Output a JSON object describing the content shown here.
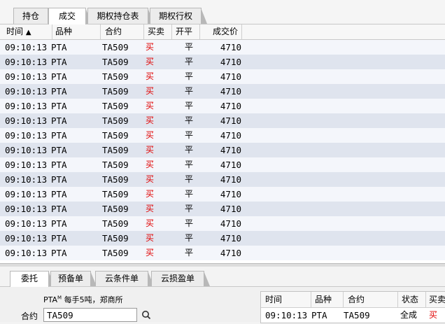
{
  "top_tabs": [
    {
      "label": "持仓",
      "active": false
    },
    {
      "label": "成交",
      "active": true
    },
    {
      "label": "期权持仓表",
      "active": false
    },
    {
      "label": "期权行权",
      "active": false
    }
  ],
  "trades": {
    "columns": {
      "time": "时间",
      "sort_indicator": "▲",
      "product": "品种",
      "contract": "合约",
      "side": "买卖",
      "open_close": "开平",
      "price": "成交价"
    },
    "rows": [
      {
        "time": "09:10:13",
        "product": "PTA",
        "contract": "TA509",
        "side": "买",
        "open_close": "平",
        "price": "4710"
      },
      {
        "time": "09:10:13",
        "product": "PTA",
        "contract": "TA509",
        "side": "买",
        "open_close": "平",
        "price": "4710"
      },
      {
        "time": "09:10:13",
        "product": "PTA",
        "contract": "TA509",
        "side": "买",
        "open_close": "平",
        "price": "4710"
      },
      {
        "time": "09:10:13",
        "product": "PTA",
        "contract": "TA509",
        "side": "买",
        "open_close": "平",
        "price": "4710"
      },
      {
        "time": "09:10:13",
        "product": "PTA",
        "contract": "TA509",
        "side": "买",
        "open_close": "平",
        "price": "4710"
      },
      {
        "time": "09:10:13",
        "product": "PTA",
        "contract": "TA509",
        "side": "买",
        "open_close": "平",
        "price": "4710"
      },
      {
        "time": "09:10:13",
        "product": "PTA",
        "contract": "TA509",
        "side": "买",
        "open_close": "平",
        "price": "4710"
      },
      {
        "time": "09:10:13",
        "product": "PTA",
        "contract": "TA509",
        "side": "买",
        "open_close": "平",
        "price": "4710"
      },
      {
        "time": "09:10:13",
        "product": "PTA",
        "contract": "TA509",
        "side": "买",
        "open_close": "平",
        "price": "4710"
      },
      {
        "time": "09:10:13",
        "product": "PTA",
        "contract": "TA509",
        "side": "买",
        "open_close": "平",
        "price": "4710"
      },
      {
        "time": "09:10:13",
        "product": "PTA",
        "contract": "TA509",
        "side": "买",
        "open_close": "平",
        "price": "4710"
      },
      {
        "time": "09:10:13",
        "product": "PTA",
        "contract": "TA509",
        "side": "买",
        "open_close": "平",
        "price": "4710"
      },
      {
        "time": "09:10:13",
        "product": "PTA",
        "contract": "TA509",
        "side": "买",
        "open_close": "平",
        "price": "4710"
      },
      {
        "time": "09:10:13",
        "product": "PTA",
        "contract": "TA509",
        "side": "买",
        "open_close": "平",
        "price": "4710"
      },
      {
        "time": "09:10:13",
        "product": "PTA",
        "contract": "TA509",
        "side": "买",
        "open_close": "平",
        "price": "4710"
      }
    ]
  },
  "bottom_tabs": [
    {
      "label": "委托",
      "active": true
    },
    {
      "label": "预备单",
      "active": false
    },
    {
      "label": "云条件单",
      "active": false
    },
    {
      "label": "云损盈单",
      "active": false
    }
  ],
  "order_panel": {
    "product_info_prefix": "PTA",
    "product_info_sup": "M",
    "product_info_rest": " 每手5吨，郑商所",
    "contract_label": "合约",
    "contract_value": "TA509",
    "search_icon": "search-icon"
  },
  "mini_table": {
    "columns": {
      "time": "时间",
      "product": "品种",
      "contract": "合约",
      "status": "状态",
      "side": "买卖"
    },
    "row": {
      "time": "09:10:13",
      "product": "PTA",
      "contract": "TA509",
      "status": "全成",
      "side": "买"
    }
  },
  "colors": {
    "buy": "#e00000",
    "row_alt": "#dfe4ee"
  }
}
